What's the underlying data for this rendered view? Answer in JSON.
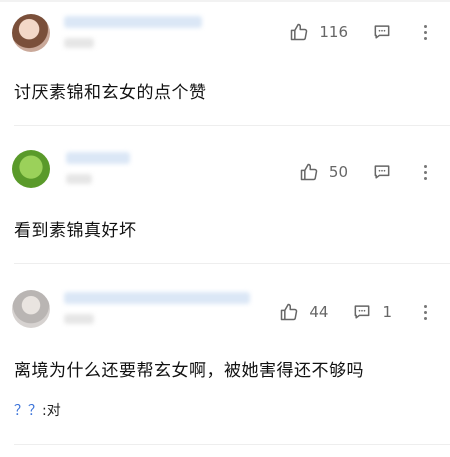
{
  "comments": [
    {
      "likes": "116",
      "text": "讨厌素锦和玄女的点个赞"
    },
    {
      "likes": "50",
      "text": "看到素锦真好坏"
    },
    {
      "likes": "44",
      "replies": "1",
      "text": "离境为什么还要帮玄女啊，被她害得还不够吗",
      "sub_reply": {
        "user": "？？",
        "sep": ":",
        "text": "对"
      }
    }
  ],
  "icons": {
    "like": "thumbs-up-icon",
    "reply": "comment-bubble-icon",
    "more": "more-vertical-icon"
  },
  "colors": {
    "link": "#3b73d9",
    "icon": "#666666"
  }
}
